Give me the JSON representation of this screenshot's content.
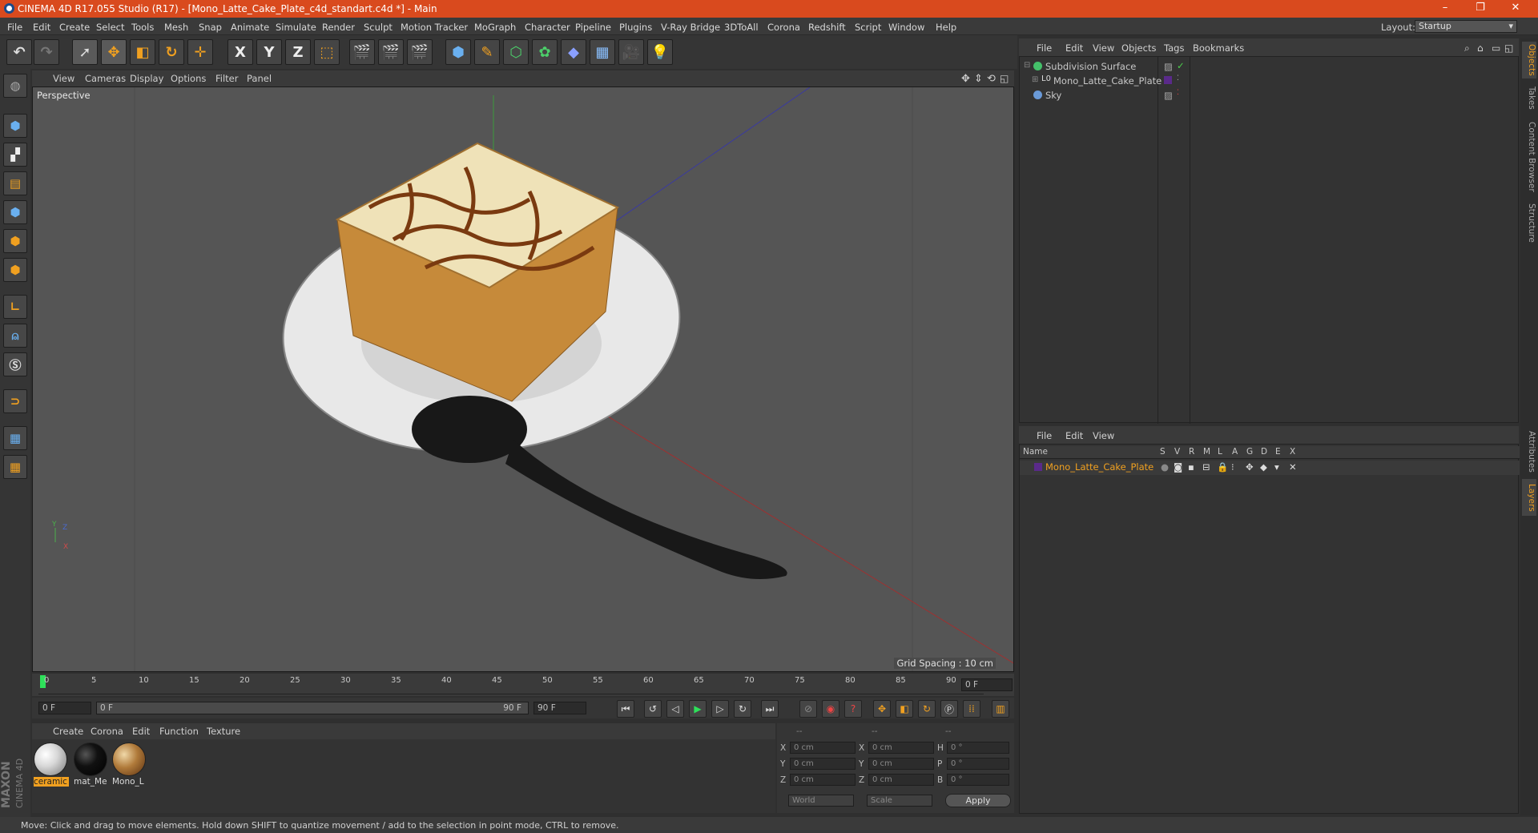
{
  "window": {
    "title": "CINEMA 4D R17.055 Studio (R17) - [Mono_Latte_Cake_Plate_c4d_standart.c4d *] - Main",
    "controls": [
      "–",
      "❐",
      "✕"
    ]
  },
  "menubar": {
    "items": [
      "File",
      "Edit",
      "Create",
      "Select",
      "Tools",
      "Mesh",
      "Snap",
      "Animate",
      "Simulate",
      "Render",
      "Sculpt",
      "Motion Tracker",
      "MoGraph",
      "Character",
      "Pipeline",
      "Plugins",
      "V-Ray Bridge",
      "3DToAll",
      "Corona",
      "Redshift",
      "Script",
      "Window",
      "Help"
    ],
    "layout_label": "Layout:",
    "layout_value": "Startup"
  },
  "toolbar": {
    "axis_x": "X",
    "axis_y": "Y",
    "axis_z": "Z"
  },
  "viewport": {
    "menu": [
      "View",
      "Cameras",
      "Display",
      "Options",
      "Filter",
      "Panel"
    ],
    "label": "Perspective",
    "grid_spacing": "Grid Spacing : 10 cm"
  },
  "timeline": {
    "ticks": [
      "0",
      "5",
      "10",
      "15",
      "20",
      "25",
      "30",
      "35",
      "40",
      "45",
      "50",
      "55",
      "60",
      "65",
      "70",
      "75",
      "80",
      "85",
      "90"
    ],
    "current_frame": "0 F",
    "start_field": "0 F",
    "range_start": "0 F",
    "range_end": "90 F",
    "end_field": "90 F"
  },
  "materials": {
    "menu": [
      "Create",
      "Corona",
      "Edit",
      "Function",
      "Texture"
    ],
    "items": [
      {
        "label": "ceramic",
        "color": "#d8d8d8"
      },
      {
        "label": "mat_Me",
        "color": "#111111"
      },
      {
        "label": "Mono_L",
        "color": "#b07a3a"
      }
    ]
  },
  "coords": {
    "header": [
      "--",
      "--",
      "--"
    ],
    "rows": [
      {
        "a": "X",
        "v1": "0 cm",
        "b": "X",
        "v2": "0 cm",
        "c": "H",
        "v3": "0 °"
      },
      {
        "a": "Y",
        "v1": "0 cm",
        "b": "Y",
        "v2": "0 cm",
        "c": "P",
        "v3": "0 °"
      },
      {
        "a": "Z",
        "v1": "0 cm",
        "b": "Z",
        "v2": "0 cm",
        "c": "B",
        "v3": "0 °"
      }
    ],
    "world": "World",
    "scale": "Scale",
    "apply": "Apply"
  },
  "object_manager": {
    "menu": [
      "File",
      "Edit",
      "View",
      "Objects",
      "Tags",
      "Bookmarks"
    ],
    "objects": [
      {
        "name": "Subdivision Surface",
        "color": "#44c06a"
      },
      {
        "name": "Mono_Latte_Cake_Plate",
        "color": "#aaaaaa"
      },
      {
        "name": "Sky",
        "color": "#6a9ad8"
      }
    ]
  },
  "layer_manager": {
    "menu": [
      "File",
      "Edit",
      "View"
    ],
    "columns": [
      "Name",
      "S",
      "V",
      "R",
      "M",
      "L",
      "A",
      "G",
      "D",
      "E",
      "X"
    ],
    "layer_name": "Mono_Latte_Cake_Plate"
  },
  "right_tabs": [
    "Objects",
    "Takes",
    "Content Browser",
    "Structure",
    "Attributes",
    "Layers"
  ],
  "branding": {
    "line1": "MAXON",
    "line2": "CINEMA 4D"
  },
  "status": "Move: Click and drag to move elements. Hold down SHIFT to quantize movement / add to the selection in point mode, CTRL to remove."
}
